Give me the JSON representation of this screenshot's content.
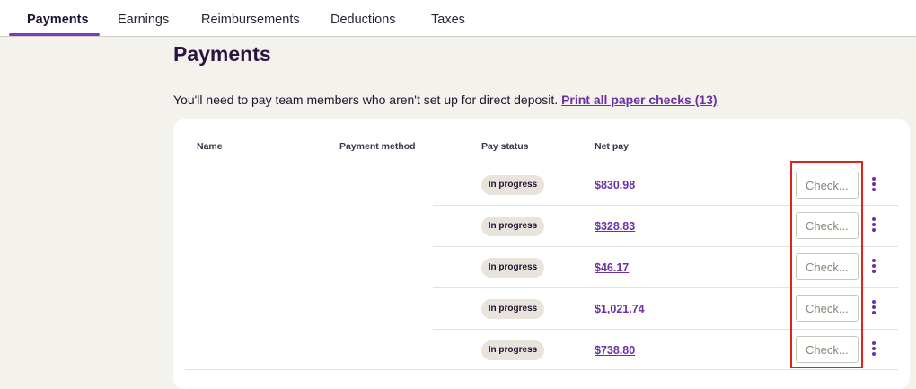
{
  "tabs": [
    {
      "label": "Payments"
    },
    {
      "label": "Earnings"
    },
    {
      "label": "Reimbursements"
    },
    {
      "label": "Deductions"
    },
    {
      "label": "Taxes"
    }
  ],
  "page": {
    "title": "Payments",
    "notice_text": "You'll need to pay team members who aren't set up for direct deposit.",
    "notice_link": "Print all paper checks (13)"
  },
  "table": {
    "headers": {
      "name": "Name",
      "payment_method": "Payment method",
      "pay_status": "Pay status",
      "net_pay": "Net pay"
    },
    "rows": [
      {
        "status": "In progress",
        "net_pay": "$830.98",
        "check_placeholder": "Check..."
      },
      {
        "status": "In progress",
        "net_pay": "$328.83",
        "check_placeholder": "Check..."
      },
      {
        "status": "In progress",
        "net_pay": "$46.17",
        "check_placeholder": "Check..."
      },
      {
        "status": "In progress",
        "net_pay": "$1,021.74",
        "check_placeholder": "Check..."
      },
      {
        "status": "In progress",
        "net_pay": "$738.80",
        "check_placeholder": "Check..."
      }
    ]
  },
  "colors": {
    "accent": "#6b2fa8",
    "highlight": "#e0241b"
  }
}
